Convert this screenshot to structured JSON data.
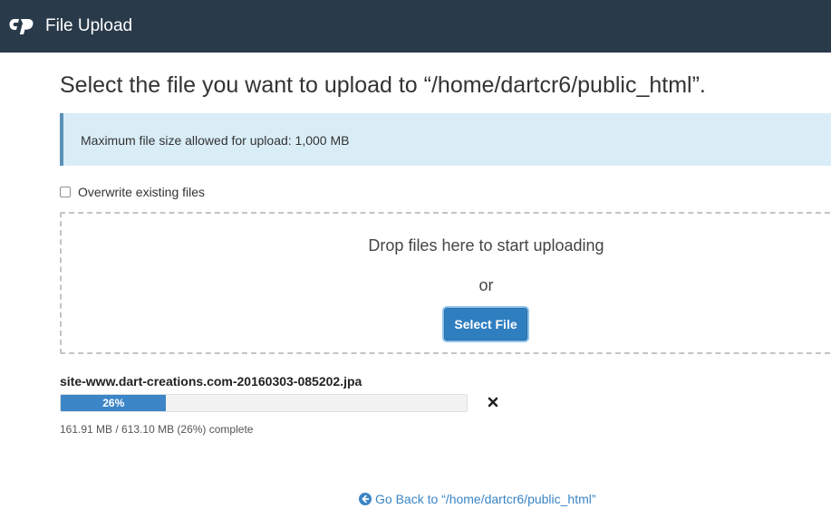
{
  "header": {
    "logo_icon": "cpanel-logo-icon",
    "title": "File Upload",
    "background": "#293a4a"
  },
  "page": {
    "heading": "Select the file you want to upload to “/home/dartcr6/public_html”."
  },
  "alert": {
    "text": "Maximum file size allowed for upload: 1,000 MB"
  },
  "options": {
    "overwrite_label": "Overwrite existing files",
    "overwrite_checked": false
  },
  "dropzone": {
    "drop_text": "Drop files here to start uploading",
    "or_text": "or",
    "select_button_label": "Select File"
  },
  "upload": {
    "file_name": "site-www.dart-creations.com-20160303-085202.jpa",
    "progress_percent": 26,
    "progress_label": "26%",
    "status_text": "161.91 MB / 613.10 MB (26%) complete",
    "cancel_icon": "close-icon"
  },
  "footer": {
    "back_icon": "arrow-left-circle-icon",
    "back_link_label": "Go Back to “/home/dartcr6/public_html”"
  },
  "colors": {
    "accent": "#2f7ec0",
    "link": "#3a85c6",
    "alert_bg": "#d9edf7"
  }
}
